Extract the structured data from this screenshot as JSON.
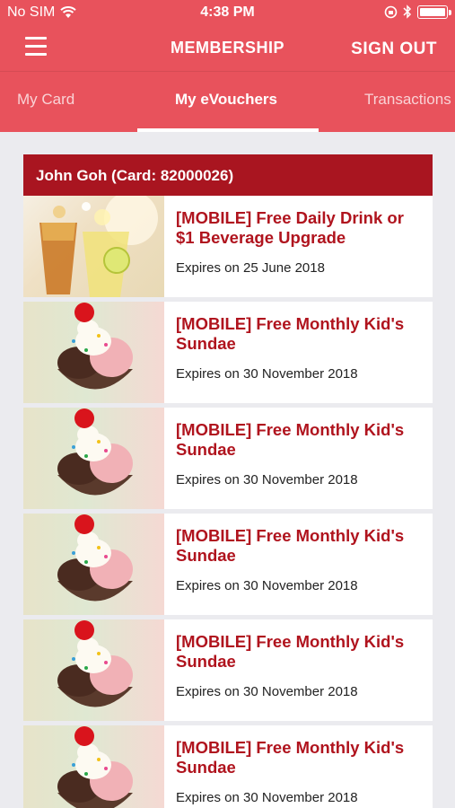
{
  "status_bar": {
    "carrier": "No SIM",
    "time": "4:38 PM",
    "battery_level": 1.0
  },
  "header": {
    "title": "MEMBERSHIP",
    "sign_out_label": "SIGN OUT",
    "menu_icon": "hamburger-icon"
  },
  "tabs": [
    {
      "label": "My Card",
      "active": false
    },
    {
      "label": "My eVouchers",
      "active": true
    },
    {
      "label": "Transactions",
      "active": false
    }
  ],
  "card": {
    "header": "John Goh (Card: 82000026)"
  },
  "vouchers": [
    {
      "title": "[MOBILE] Free Daily Drink or $1 Beverage Upgrade",
      "expiry": "Expires on 25 June 2018",
      "image": "drink"
    },
    {
      "title": "[MOBILE] Free Monthly Kid's Sundae",
      "expiry": "Expires on 30 November 2018",
      "image": "sundae"
    },
    {
      "title": "[MOBILE] Free Monthly Kid's Sundae",
      "expiry": "Expires on 30 November 2018",
      "image": "sundae"
    },
    {
      "title": "[MOBILE] Free Monthly Kid's Sundae",
      "expiry": "Expires on 30 November 2018",
      "image": "sundae"
    },
    {
      "title": "[MOBILE] Free Monthly Kid's Sundae",
      "expiry": "Expires on 30 November 2018",
      "image": "sundae"
    },
    {
      "title": "[MOBILE] Free Monthly Kid's Sundae",
      "expiry": "Expires on 30 November 2018",
      "image": "sundae"
    }
  ],
  "colors": {
    "brand": "#e8525c",
    "card_header": "#a91520",
    "voucher_title": "#b0141e",
    "background": "#ebebef"
  }
}
